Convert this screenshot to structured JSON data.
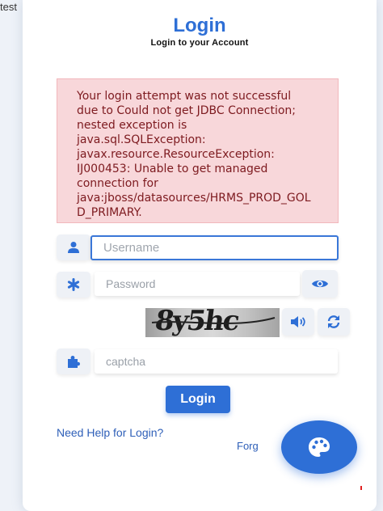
{
  "corner_text": "test",
  "header": {
    "title": "Login",
    "subtitle": "Login to your Account"
  },
  "alert": {
    "message": "Your login attempt was not successful\ndue to Could not get JDBC Connection;\nnested exception is\njava.sql.SQLException:\njavax.resource.ResourceException:\nIJ000453: Unable to get managed\nconnection for\njava:jboss/datasources/HRMS_PROD_GOL\nD_PRIMARY."
  },
  "form": {
    "username_placeholder": "Username",
    "password_placeholder": "Password",
    "captcha_image_text": "8y5hc",
    "captcha_placeholder": "captcha",
    "login_label": "Login"
  },
  "links": {
    "help": "Need Help for Login?",
    "forgot_prefix": "Forg",
    "forgot_suffix": "?"
  },
  "icons": {
    "username": "user-icon",
    "password": "asterisk-icon",
    "show_password": "eye-icon",
    "audio": "speaker-icon",
    "refresh": "refresh-icon",
    "captcha": "puzzle-icon",
    "theme": "palette-icon"
  },
  "colors": {
    "accent": "#2e6fd6",
    "alert_bg": "#f8d7da",
    "alert_text": "#7d1a1f"
  }
}
